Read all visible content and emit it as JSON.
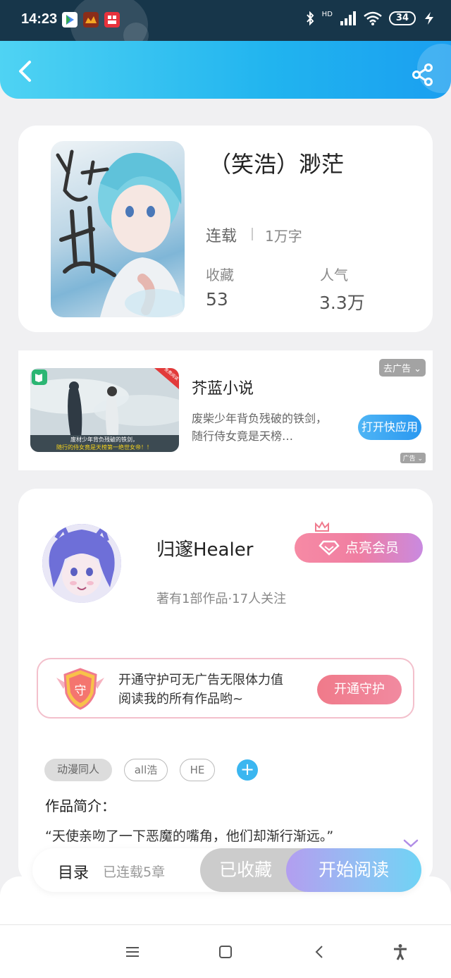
{
  "status_bar": {
    "time": "14:23",
    "hd": "HD",
    "battery": "34",
    "icons": [
      "play-store-icon",
      "game-icon",
      "app-icon",
      "bluetooth-icon",
      "signal-icon",
      "wifi-icon",
      "battery-icon",
      "charging-icon"
    ]
  },
  "header": {
    "back_icon": "back-arrow-icon",
    "share_icon": "share-icon"
  },
  "book": {
    "title": "（笑浩）渺茫",
    "status": "连载",
    "words": "1万字",
    "favorites_label": "收藏",
    "favorites_value": "53",
    "popularity_label": "人气",
    "popularity_value": "3.3万"
  },
  "ad": {
    "remove_label": "去广告",
    "name": "芥蓝小说",
    "description": "废柴少年背负残破的铁剑，随行侍女竟是天榜…",
    "button": "打开快应用",
    "mark": "广告",
    "image_caption1": "废材少年背负残破的铁剑，",
    "image_caption2": "随行的侍女竟是天榜第一绝世女帝！！",
    "image_tag": "免费阅读"
  },
  "author": {
    "name": "归邃Healer",
    "meta": "著有1部作品·17人关注",
    "vip_button": "点亮会员"
  },
  "guard": {
    "badge": "守",
    "line1": "开通守护可无广告无限体力值",
    "line2": "阅读我的所有作品哟~",
    "button": "开通守护"
  },
  "tags": [
    "动漫同人",
    "all浩",
    "HE"
  ],
  "intro": {
    "title": "作品简介：",
    "text": "“天使亲吻了一下恶魔的嘴角，他们却渐行渐远。”"
  },
  "actions": {
    "toc": "目录",
    "chapter_count": "已连载5章",
    "favorited": "已收藏",
    "read": "开始阅读"
  },
  "colors": {
    "accent": "#21b4ef",
    "pink": "#f07ea2",
    "status_bar": "#17364a"
  }
}
